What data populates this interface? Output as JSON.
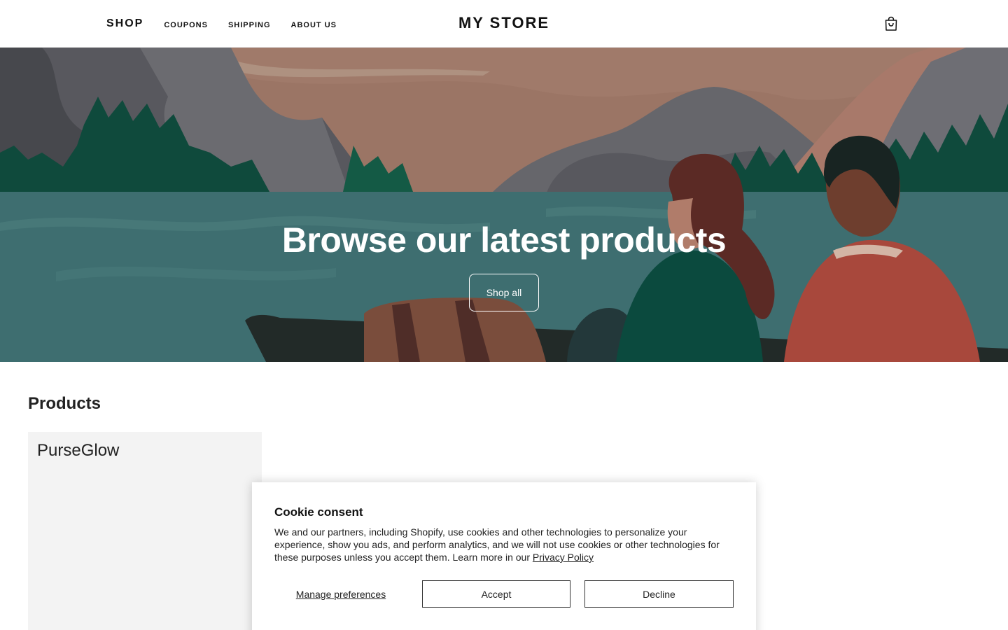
{
  "header": {
    "nav": {
      "shop_label": "SHOP",
      "links": [
        "COUPONS",
        "SHIPPING",
        "ABOUT US"
      ]
    },
    "brand": "MY STORE",
    "cart_icon": "shopping-bag-icon"
  },
  "hero": {
    "title": "Browse our latest products",
    "button_label": "Shop all"
  },
  "products": {
    "heading": "Products",
    "items": [
      {
        "name": "PurseGlow"
      }
    ]
  },
  "cookie": {
    "title": "Cookie consent",
    "body": "We and our partners, including Shopify, use cookies and other technologies to personalize your experience, show you ads, and perform analytics, and we will not use cookies or other technologies for these purposes unless you accept them. Learn more in our ",
    "link_label": "Privacy Policy",
    "manage_label": "Manage preferences",
    "accept_label": "Accept",
    "decline_label": "Decline"
  },
  "colors": {
    "water": "#3e6e70",
    "tree": "#0f4a3c",
    "mountain": "#6e6e72",
    "sky": "#9b7565"
  }
}
